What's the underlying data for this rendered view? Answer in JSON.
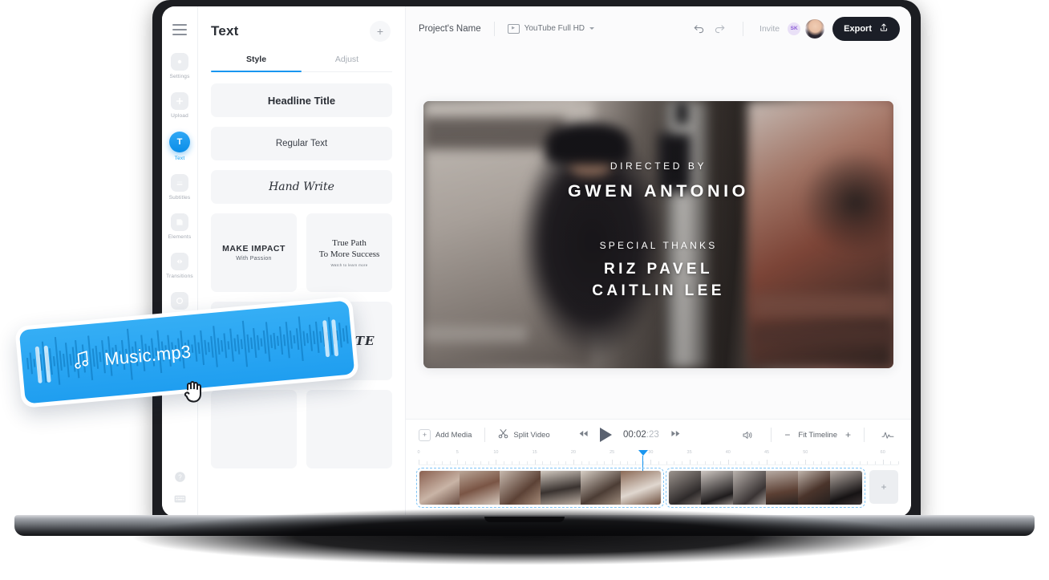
{
  "rail": {
    "menu_icon": "hamburger-icon",
    "items": [
      {
        "label": "Settings",
        "icon": "settings-icon",
        "active": false
      },
      {
        "label": "Upload",
        "icon": "upload-plus-icon",
        "active": false
      },
      {
        "label": "Text",
        "icon": "text-T-icon",
        "active": true,
        "glyph": "T"
      },
      {
        "label": "Subtitles",
        "icon": "subtitles-icon",
        "active": false
      },
      {
        "label": "Elements",
        "icon": "elements-icon",
        "active": false
      },
      {
        "label": "Transitions",
        "icon": "transitions-icon",
        "active": false
      }
    ],
    "bottom": [
      {
        "label": "help",
        "icon": "help-circle-icon"
      },
      {
        "label": "shortcuts",
        "icon": "keyboard-icon"
      }
    ]
  },
  "panel": {
    "title": "Text",
    "add_button": "+",
    "tabs": [
      {
        "label": "Style",
        "active": true
      },
      {
        "label": "Adjust",
        "active": false
      }
    ],
    "styles": [
      {
        "name": "Headline Title",
        "kind": "headline"
      },
      {
        "name": "Regular Text",
        "kind": "regular"
      },
      {
        "name": "Hand Write",
        "kind": "hand"
      }
    ],
    "grid": [
      {
        "title": "MAKE IMPACT",
        "subtitle": "With Passion",
        "kind": "impact"
      },
      {
        "title": "True Path\nTo More Success",
        "subtitle": "Watch to learn more",
        "kind": "serif"
      },
      {
        "title": "",
        "subtitle": "",
        "kind": "blank"
      },
      {
        "title": "WRITE",
        "subtitle": "",
        "kind": "write"
      }
    ]
  },
  "topbar": {
    "project_name": "Project's Name",
    "ratio_label": "YouTube Full HD",
    "ratio_icon": "video-format-icon",
    "undo_icon": "undo-arrow-icon",
    "redo_icon": "redo-arrow-icon",
    "invite_label": "Invite",
    "avatar_initials": "SK",
    "export_label": "Export",
    "export_icon": "upload-share-icon"
  },
  "preview": {
    "credits": {
      "directed_by_label": "DIRECTED BY",
      "director_name": "GWEN ANTONIO",
      "special_thanks_label": "SPECIAL THANKS",
      "thanks_1": "RIZ PAVEL",
      "thanks_2": "CAITLIN LEE"
    }
  },
  "timeline": {
    "add_media_label": "Add Media",
    "split_video_label": "Split Video",
    "split_icon": "scissors-icon",
    "skip_back_icon": "skip-back-icon",
    "play_icon": "play-icon",
    "skip_forward_icon": "skip-forward-icon",
    "timecode": "00:02",
    "timecode_frames": ":23",
    "volume_icon": "volume-icon",
    "zoom_out_label": "−",
    "fit_label": "Fit Timeline",
    "zoom_in_label": "+",
    "waveform_icon": "audio-waveform-icon",
    "ruler_ticks": [
      0,
      5,
      10,
      15,
      20,
      25,
      30,
      35,
      40,
      45,
      50,
      60
    ],
    "playhead_seconds": 29,
    "add_clip_label": "+",
    "clips": [
      {
        "name": "clip-1",
        "thumbs": 6
      },
      {
        "name": "clip-2",
        "thumbs": 6
      }
    ]
  },
  "music_card": {
    "file_name": "Music.mp3",
    "note_icon": "music-note-icon",
    "cursor_icon": "grab-hand-cursor",
    "accent_color": "#1f9ef0"
  },
  "colors": {
    "accent": "#1996f0",
    "export_bg": "#1b1e27",
    "panel_card": "#f5f6f8",
    "text_dark": "#2b2f36",
    "text_muted": "#a8aeb6"
  }
}
